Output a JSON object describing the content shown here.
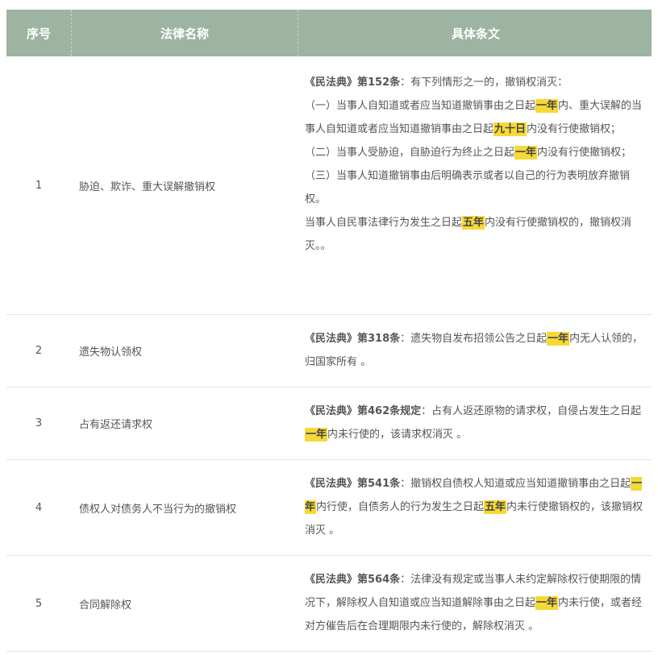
{
  "header": {
    "col1": "序号",
    "col2": "法律名称",
    "col3": "具体条文"
  },
  "rows": [
    {
      "no": "1",
      "name": "胁迫、欺诈、重大误解撤销权",
      "paras": [
        {
          "bold": "《民法典》第152条",
          "t1": "：有下列情形之一的，撤销权消灭："
        },
        {
          "t1": "（一）当事人自知道或者应当知道撤销事由之日起",
          "h1": "一年",
          "t2": "内、重大误解的当事人自知道或者应当知道撤销事由之日起",
          "h2": "九十日",
          "t3": "内没有行使撤销权；"
        },
        {
          "t1": "（二）当事人受胁迫，自胁迫行为终止之日起",
          "h1": "一年",
          "t2": "内没有行使撤销权；"
        },
        {
          "t1": "（三）当事人知道撤销事由后明确表示或者以自己的行为表明放弃撤销权。"
        },
        {
          "t1": "当事人自民事法律行为发生之日起",
          "h1": "五年",
          "t2": "内没有行使撤销权的，撤销权消灭。。"
        }
      ]
    },
    {
      "no": "2",
      "name": "遗失物认领权",
      "paras": [
        {
          "bold": "《民法典》第318条",
          "t1": "：遗失物自发布招领公告之日起",
          "h1": "一年",
          "t2": "内无人认领的，归国家所有 。"
        }
      ]
    },
    {
      "no": "3",
      "name": "占有返还请求权",
      "paras": [
        {
          "bold": "《民法典》第462条规定",
          "t1": "：占有人返还原物的请求权，自侵占发生之日起",
          "h1": "一年",
          "t2": "内未行使的，该请求权消灭 。"
        }
      ]
    },
    {
      "no": "4",
      "name": "债权人对债务人不当行为的撤销权",
      "paras": [
        {
          "bold": "《民法典》第541条",
          "t1": "：撤销权自债权人知道或应当知道撤销事由之日起",
          "h1": "一年",
          "t2": "内行使，自债务人的行为发生之日起",
          "h2": "五年",
          "t3": "内未行使撤销权的，该撤销权消灭 。"
        }
      ]
    },
    {
      "no": "5",
      "name": "合同解除权",
      "paras": [
        {
          "bold": "《民法典》第564条",
          "t1": "：法律没有规定或当事人未约定解除权行使期限的情况下，解除权人自知道或应当知道解除事由之日起",
          "h1": "一年",
          "t2": "内未行使，或者经对方催告后在合理期限内未行使的，解除权消灭 。"
        }
      ]
    }
  ]
}
